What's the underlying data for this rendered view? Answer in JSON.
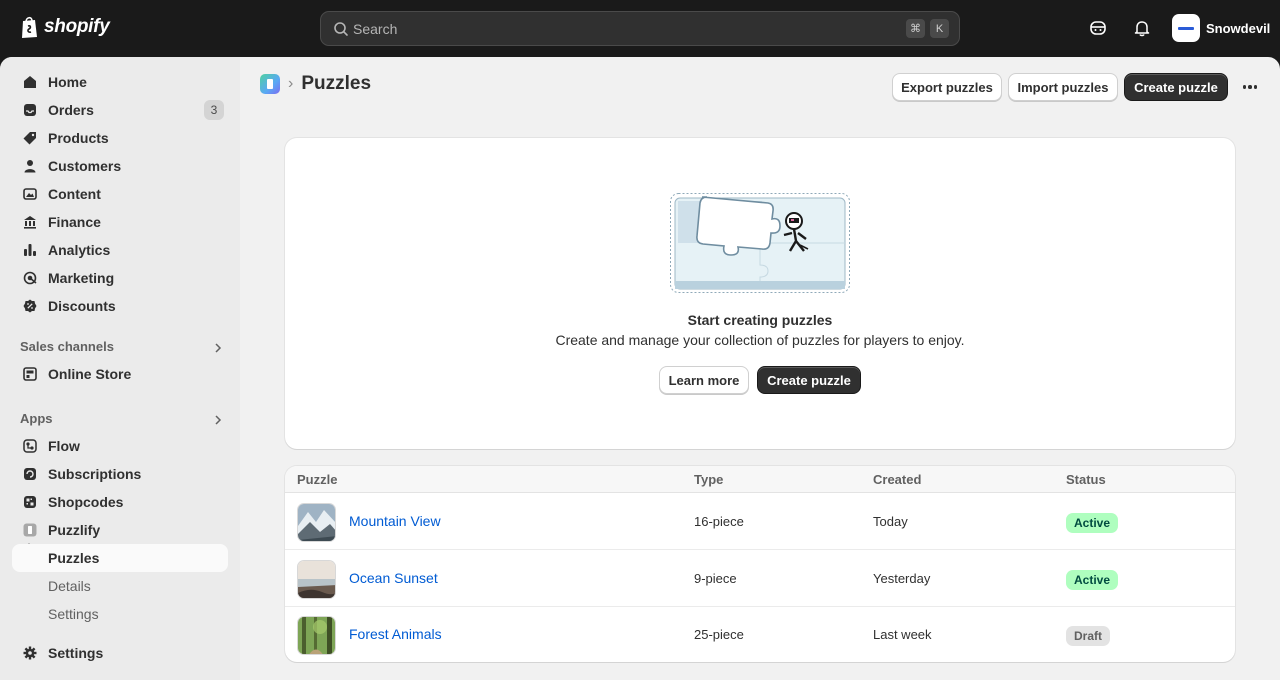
{
  "topbar": {
    "brand": "shopify",
    "search_placeholder": "Search",
    "shortcut_keys": [
      "⌘",
      "K"
    ],
    "store_name": "Snowdevil"
  },
  "sidebar": {
    "items": [
      {
        "label": "Home",
        "icon": "home-icon"
      },
      {
        "label": "Orders",
        "icon": "inbox-icon",
        "badge": "3"
      },
      {
        "label": "Products",
        "icon": "tag-icon"
      },
      {
        "label": "Customers",
        "icon": "person-icon"
      },
      {
        "label": "Content",
        "icon": "image-icon"
      },
      {
        "label": "Finance",
        "icon": "bank-icon"
      },
      {
        "label": "Analytics",
        "icon": "bar-chart-icon"
      },
      {
        "label": "Marketing",
        "icon": "target-icon"
      },
      {
        "label": "Discounts",
        "icon": "discount-icon"
      }
    ],
    "sales_channels": {
      "heading": "Sales channels",
      "items": [
        {
          "label": "Online Store",
          "icon": "store-icon"
        }
      ]
    },
    "apps": {
      "heading": "Apps",
      "items": [
        {
          "label": "Flow",
          "icon": "flow-icon"
        },
        {
          "label": "Subscriptions",
          "icon": "subscriptions-icon"
        },
        {
          "label": "Shopcodes",
          "icon": "qr-icon"
        },
        {
          "label": "Puzzlify",
          "icon": "puzzlify-icon"
        }
      ],
      "subitems": [
        {
          "label": "Puzzles",
          "active": true
        },
        {
          "label": "Details"
        },
        {
          "label": "Settings"
        }
      ]
    },
    "settings_label": "Settings"
  },
  "page": {
    "title": "Puzzles",
    "actions": {
      "export": "Export puzzles",
      "import": "Import puzzles",
      "create": "Create puzzle"
    }
  },
  "empty_state": {
    "heading": "Start creating puzzles",
    "text": "Create and manage your collection of puzzles for players to enjoy.",
    "learn_more": "Learn more",
    "create": "Create puzzle"
  },
  "table": {
    "headers": [
      "Puzzle",
      "Type",
      "Created",
      "Status"
    ],
    "rows": [
      {
        "name": "Mountain View",
        "type": "16-piece",
        "created": "Today",
        "status": "Active"
      },
      {
        "name": "Ocean Sunset",
        "type": "9-piece",
        "created": "Yesterday",
        "status": "Active"
      },
      {
        "name": "Forest Animals",
        "type": "25-piece",
        "created": "Last week",
        "status": "Draft"
      }
    ]
  },
  "colors": {
    "topbar": "#1a1a1a",
    "link": "#005bd3",
    "status_active_bg": "#affebf",
    "status_draft_bg": "#e3e3e3",
    "primary_button": "#303030"
  }
}
